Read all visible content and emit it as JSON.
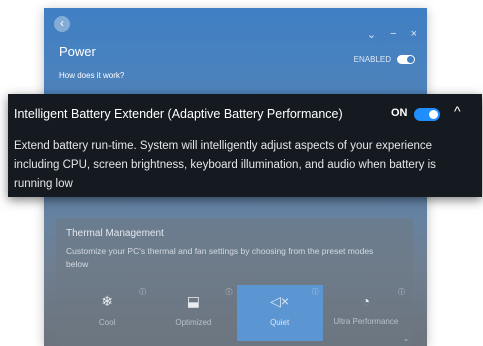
{
  "window": {
    "back_icon": "‹",
    "minimize_icon": "−",
    "close_icon": "×",
    "chevron_icon": "⌄",
    "title": "Power",
    "enabled_label": "ENABLED",
    "how_link": "How does it work?"
  },
  "thermal": {
    "title": "Thermal Management",
    "description": "Customize your PC's thermal and fan settings by choosing from the preset modes below",
    "modes": [
      {
        "icon": "❄",
        "label": "Cool",
        "info": "ⓘ"
      },
      {
        "icon": "⬓",
        "label": "Optimized",
        "info": "ⓘ"
      },
      {
        "icon": "◁×",
        "label": "Quiet",
        "info": "ⓘ"
      },
      {
        "icon": "◔",
        "label": "Ultra Performance",
        "info": "ⓘ"
      }
    ],
    "selected": "Quiet"
  },
  "tooltip": {
    "title": "Intelligent Battery Extender (Adaptive Battery Performance)",
    "toggle_label": "ON",
    "collapse_icon": "^",
    "description": "Extend battery run-time. System will intelligently adjust aspects of your experience including CPU, screen brightness, keyboard illumination, and audio when battery is running low"
  },
  "colors": {
    "accent": "#1f8fff",
    "tooltip_bg": "#151a20",
    "window_top": "#3f7fc4",
    "selected_mode": "#5b95d2"
  }
}
